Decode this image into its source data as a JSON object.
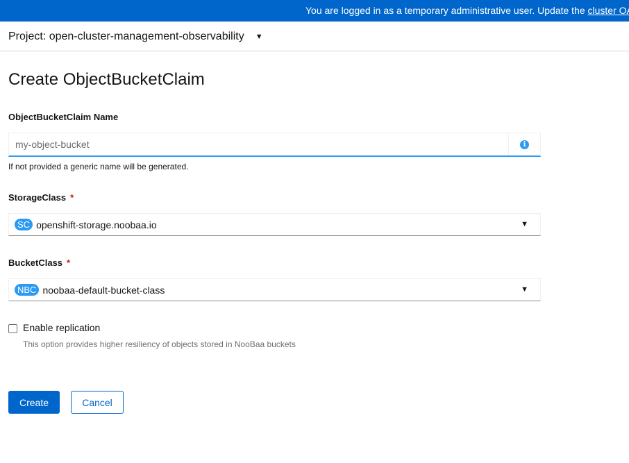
{
  "banner": {
    "text": "You are logged in as a temporary administrative user. Update the",
    "link_text": "cluster OA"
  },
  "project_bar": {
    "label": "Project: open-cluster-management-observability",
    "icon": "caret-down-icon"
  },
  "page": {
    "title": "Create ObjectBucketClaim"
  },
  "form": {
    "name_field": {
      "label": "ObjectBucketClaim Name",
      "placeholder": "my-object-bucket",
      "value": "",
      "info_icon": "info-circle-icon",
      "helper": "If not provided a generic name will be generated."
    },
    "storage_class": {
      "label": "StorageClass",
      "required_marker": "*",
      "badge": "SC",
      "value": "openshift-storage.noobaa.io"
    },
    "bucket_class": {
      "label": "BucketClass",
      "required_marker": "*",
      "badge": "NBC",
      "value": "noobaa-default-bucket-class"
    },
    "replication": {
      "label": "Enable replication",
      "description": "This option provides higher resiliency of objects stored in NooBaa buckets",
      "checked": false
    }
  },
  "actions": {
    "create_label": "Create",
    "cancel_label": "Cancel"
  },
  "colors": {
    "accent": "#0066cc",
    "badge": "#2b9af3",
    "required": "#c9190b"
  }
}
